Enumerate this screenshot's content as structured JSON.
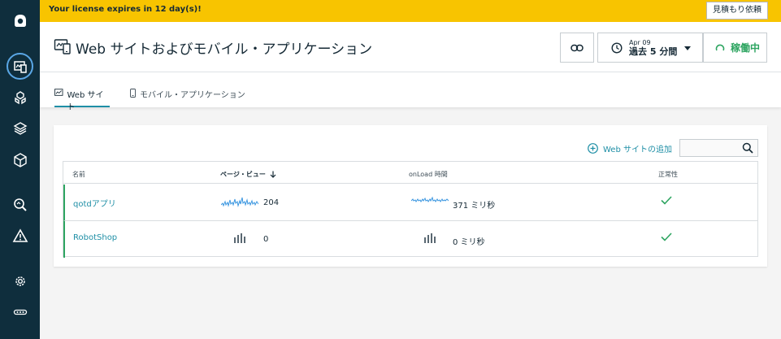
{
  "banner": {
    "license_text": "Your license expires in 12 day(s)!",
    "quote_button": "見積もり依頼",
    "color": "#f8c400"
  },
  "sidebar": {
    "icons": [
      "instana-logo-icon",
      "websites-icon",
      "infrastructure-icon",
      "platforms-icon",
      "applications-icon",
      "analytics-icon",
      "events-icon",
      "settings-icon",
      "more-icon"
    ],
    "active": "websites-icon"
  },
  "header": {
    "title": "Web サイトおよびモバイル・アプリケーション",
    "time_date": "Apr 09",
    "time_range": "過去 5 分間",
    "live_label": "稼働中",
    "live_color": "#2ea561"
  },
  "tabs": [
    {
      "label": "Web サイト",
      "active": true
    },
    {
      "label": "モバイル・アプリケーション",
      "active": false
    }
  ],
  "toolbar": {
    "add_website": "Web サイトの追加"
  },
  "table": {
    "columns": [
      "名前",
      "ページ・ビュー",
      "onLoad 時間",
      "正常性"
    ],
    "sorted_column": "ページ・ビュー",
    "rows": [
      {
        "name": "qotdアプリ",
        "page_views": "204",
        "onload": "371 ミリ秒",
        "health": "ok"
      },
      {
        "name": "RobotShop",
        "page_views": "0",
        "onload": "0 ミリ秒",
        "health": "ok"
      }
    ]
  }
}
